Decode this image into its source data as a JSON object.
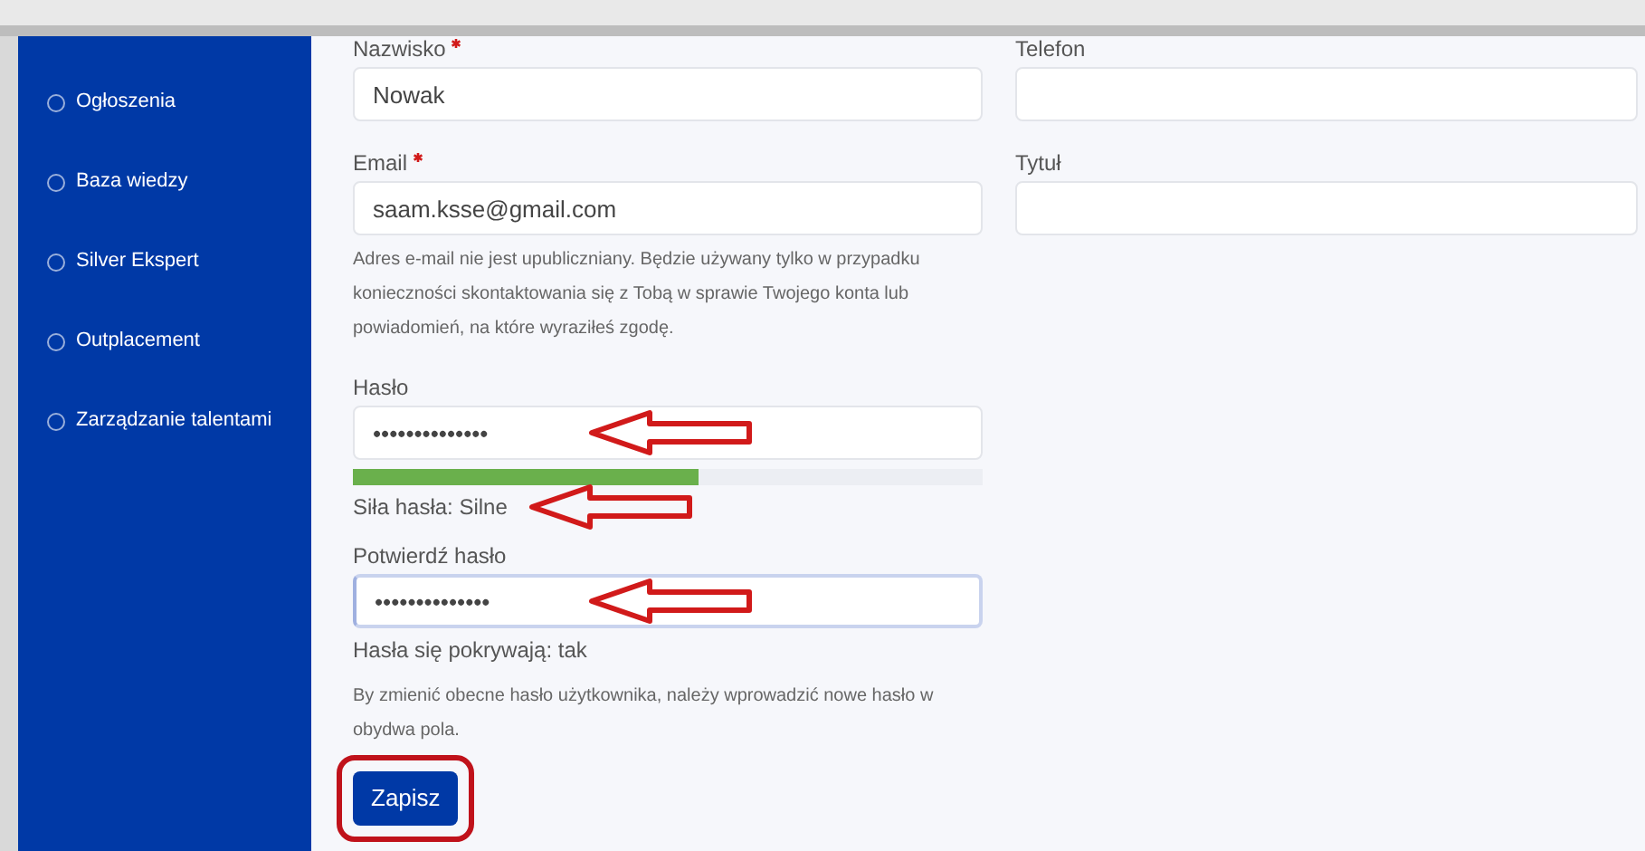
{
  "sidebar": {
    "items": [
      {
        "label": "Ogłoszenia"
      },
      {
        "label": "Baza wiedzy"
      },
      {
        "label": "Silver Ekspert"
      },
      {
        "label": "Outplacement"
      },
      {
        "label": "Zarządzanie talentami"
      }
    ]
  },
  "form": {
    "left": [
      {
        "kind": "field",
        "label": "Nazwisko",
        "required": true,
        "value": "Nowak"
      },
      {
        "kind": "field",
        "label": "Email",
        "required": true,
        "value": "saam.ksse@gmail.com"
      },
      {
        "kind": "note",
        "text": "Adres e-mail nie jest upubliczniany. Będzie używany tylko w przypadku konieczności skontaktowania się z Tobą w sprawie Twojego konta lub powiadomień, na które wyraziłeś zgodę."
      },
      {
        "kind": "field",
        "label": "Hasło",
        "required": false,
        "value": "••••••••••••••",
        "annotated": true
      },
      {
        "kind": "meter",
        "level": 0.55
      },
      {
        "kind": "status",
        "text": "Siła hasła: Silne",
        "annotated": true
      },
      {
        "kind": "field",
        "label": "Potwierdź hasło",
        "required": false,
        "value": "••••••••••••••",
        "annotated": true,
        "focused": true
      },
      {
        "kind": "status",
        "text": "Hasła się pokrywają: tak",
        "annotated": false
      },
      {
        "kind": "note",
        "text": "By zmienić obecne hasło użytkownika, należy wprowadzić nowe hasło w obydwa pola."
      },
      {
        "kind": "button",
        "label": "Zapisz",
        "highlighted": true
      }
    ],
    "right": [
      {
        "kind": "field",
        "label": "Telefon",
        "required": false
      },
      {
        "kind": "field",
        "label": "Tytuł",
        "required": false
      }
    ]
  }
}
